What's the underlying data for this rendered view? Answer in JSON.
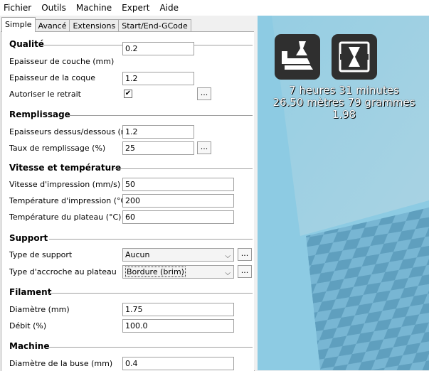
{
  "menu": {
    "items": [
      {
        "name": "fichier",
        "label": "Fichier"
      },
      {
        "name": "outils",
        "label": "Outils"
      },
      {
        "name": "machine",
        "label": "Machine"
      },
      {
        "name": "expert",
        "label": "Expert"
      },
      {
        "name": "aide",
        "label": "Aide"
      }
    ]
  },
  "tabs": {
    "simple": "Simple",
    "avance": "Avancé",
    "extensions": "Extensions",
    "gcode": "Start/End-GCode"
  },
  "sections": {
    "qualite": {
      "title": "Qualité",
      "layer_height": {
        "label": "Epaisseur de couche (mm)",
        "value": "0.2"
      },
      "shell_thickness": {
        "label": "Epaisseur de la coque",
        "value": "1.2"
      },
      "retraction": {
        "label": "Autoriser le retrait",
        "checked": "✔"
      }
    },
    "remplissage": {
      "title": "Remplissage",
      "top_bottom": {
        "label": "Epaisseurs dessus/dessous (mm)",
        "value": "1.2"
      },
      "fill_density": {
        "label": "Taux de remplissage (%)",
        "value": "25"
      }
    },
    "vitesse": {
      "title": "Vitesse et température",
      "print_speed": {
        "label": "Vitesse d'impression (mm/s)",
        "value": "50"
      },
      "print_temp": {
        "label": "Température d'impression (°C)",
        "value": "200"
      },
      "bed_temp": {
        "label": "Température du plateau (°C)",
        "value": "60"
      }
    },
    "support": {
      "title": "Support",
      "support_type": {
        "label": "Type de support",
        "value": "Aucun"
      },
      "adhesion_type": {
        "label": "Type d'accroche au plateau",
        "value": "Bordure (brim)"
      }
    },
    "filament": {
      "title": "Filament",
      "diameter": {
        "label": "Diamètre (mm)",
        "value": "1.75"
      },
      "flow": {
        "label": "Débit (%)",
        "value": "100.0"
      }
    },
    "machine": {
      "title": "Machine",
      "nozzle": {
        "label": "Diamètre de la buse (mm)",
        "value": "0.4"
      }
    }
  },
  "buttons": {
    "dots": "..."
  },
  "viewport": {
    "print_time": "7 heures 31 minutes",
    "material": "26.50 mètres 79 grammes",
    "cost": "1.98",
    "colors": {
      "background": "#8dcbe3",
      "grid_light": "#77b5d3",
      "grid_dark": "#5e9dbd",
      "button": "#2f2f2f"
    }
  }
}
